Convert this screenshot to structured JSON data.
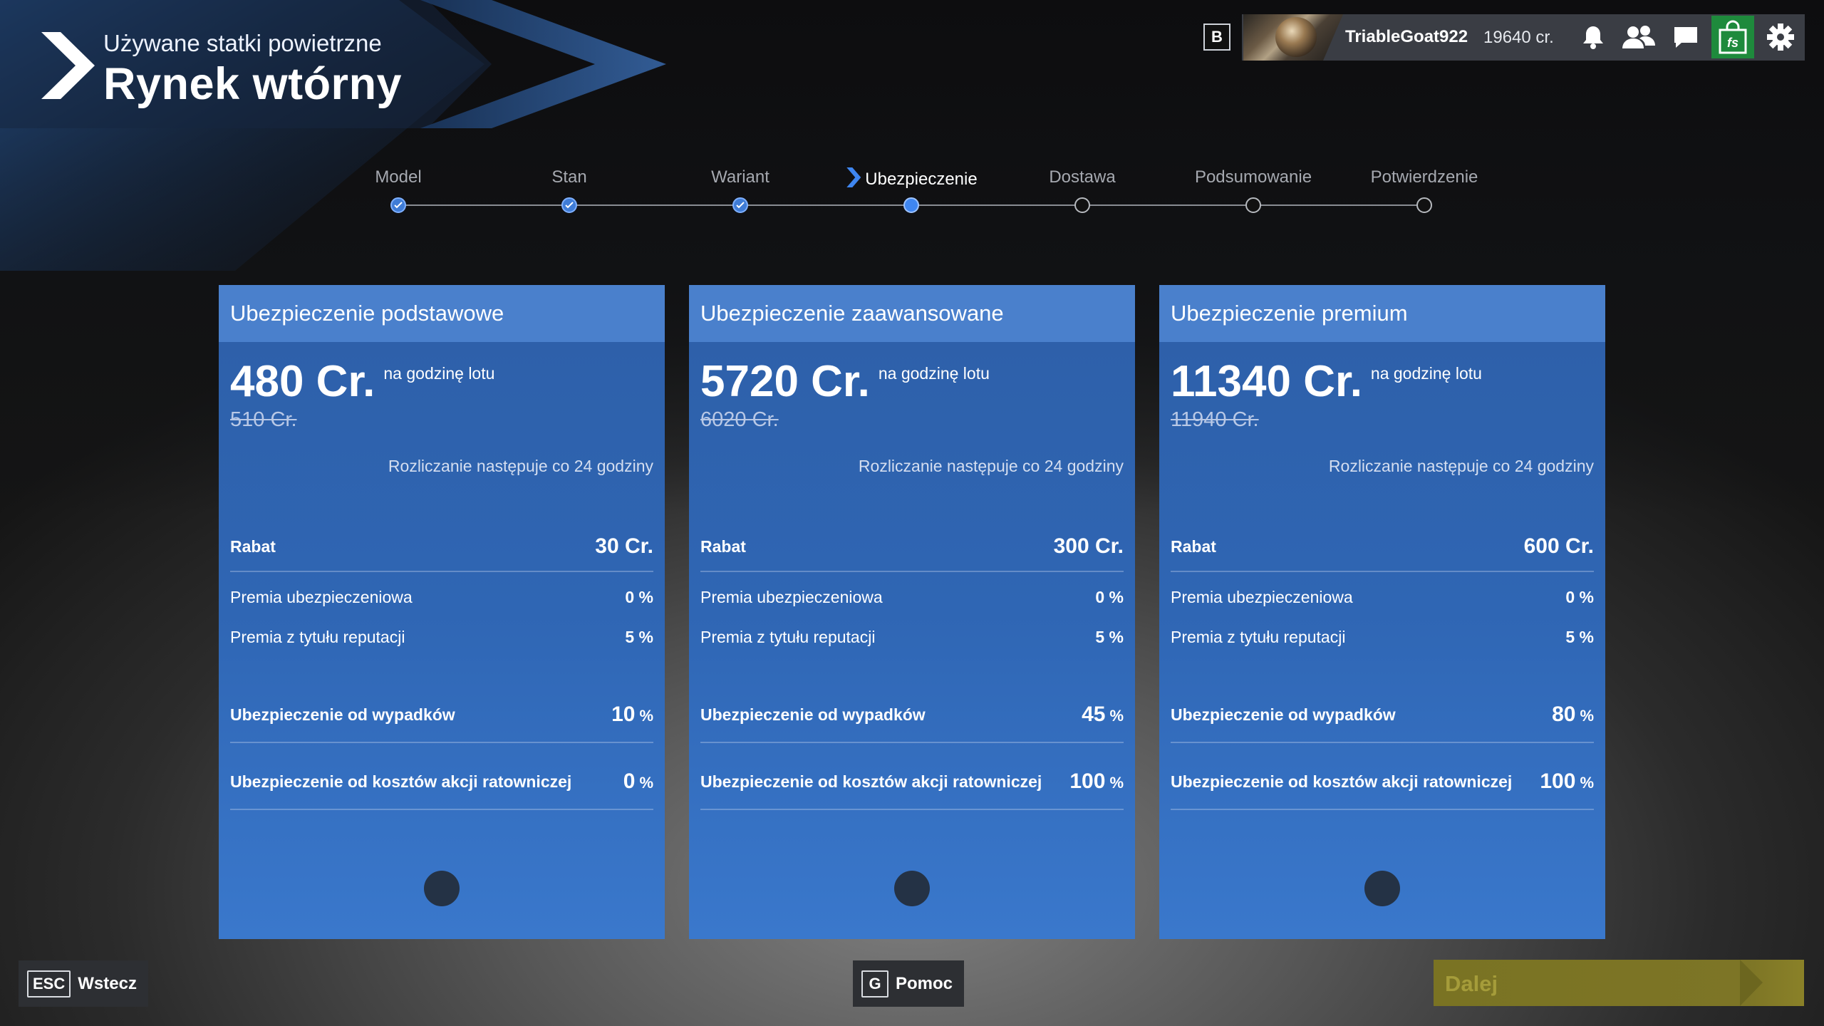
{
  "header": {
    "subtitle": "Używane statki powietrzne",
    "title": "Rynek wtórny"
  },
  "topbar": {
    "badge": "B",
    "username": "TriableGoat922",
    "credits": "19640 cr.",
    "icons": [
      "bell-icon",
      "friends-icon",
      "chat-icon",
      "shop-icon",
      "gear-icon"
    ]
  },
  "steps": [
    {
      "label": "Model",
      "state": "done"
    },
    {
      "label": "Stan",
      "state": "done"
    },
    {
      "label": "Wariant",
      "state": "done"
    },
    {
      "label": "Ubezpieczenie",
      "state": "current"
    },
    {
      "label": "Dostawa",
      "state": "todo"
    },
    {
      "label": "Podsumowanie",
      "state": "todo"
    },
    {
      "label": "Potwierdzenie",
      "state": "todo"
    }
  ],
  "cards": [
    {
      "title": "Ubezpieczenie podstawowe",
      "price": "480 Cr.",
      "per": "na godzinę lotu",
      "old_price": "510 Cr.",
      "billing": "Rozliczanie następuje co 24 godziny",
      "rabat_label": "Rabat",
      "rabat_value": "30 Cr.",
      "premia_ub_label": "Premia ubezpieczeniowa",
      "premia_ub_value": "0 %",
      "premia_rep_label": "Premia z tytułu reputacji",
      "premia_rep_value": "5 %",
      "wypadki_label": "Ubezpieczenie od wypadków",
      "wypadki_value": "10",
      "wypadki_pct": "%",
      "ratunek_label": "Ubezpieczenie od kosztów akcji ratowniczej",
      "ratunek_value": "0",
      "ratunek_pct": "%"
    },
    {
      "title": "Ubezpieczenie zaawansowane",
      "price": "5720 Cr.",
      "per": "na godzinę lotu",
      "old_price": "6020 Cr.",
      "billing": "Rozliczanie następuje co 24 godziny",
      "rabat_label": "Rabat",
      "rabat_value": "300 Cr.",
      "premia_ub_label": "Premia ubezpieczeniowa",
      "premia_ub_value": "0 %",
      "premia_rep_label": "Premia z tytułu reputacji",
      "premia_rep_value": "5 %",
      "wypadki_label": "Ubezpieczenie od wypadków",
      "wypadki_value": "45",
      "wypadki_pct": "%",
      "ratunek_label": "Ubezpieczenie od kosztów akcji ratowniczej",
      "ratunek_value": "100",
      "ratunek_pct": "%"
    },
    {
      "title": "Ubezpieczenie premium",
      "price": "11340 Cr.",
      "per": "na godzinę lotu",
      "old_price": "11940 Cr.",
      "billing": "Rozliczanie następuje co 24 godziny",
      "rabat_label": "Rabat",
      "rabat_value": "600 Cr.",
      "premia_ub_label": "Premia ubezpieczeniowa",
      "premia_ub_value": "0 %",
      "premia_rep_label": "Premia z tytułu reputacji",
      "premia_rep_value": "5 %",
      "wypadki_label": "Ubezpieczenie od wypadków",
      "wypadki_value": "80",
      "wypadki_pct": "%",
      "ratunek_label": "Ubezpieczenie od kosztów akcji ratowniczej",
      "ratunek_value": "100",
      "ratunek_pct": "%"
    }
  ],
  "bottom": {
    "back_key": "ESC",
    "back_label": "Wstecz",
    "help_key": "G",
    "help_label": "Pomoc",
    "next_label": "Dalej"
  },
  "colors": {
    "accent": "#3f86f0",
    "card": "#2f66b4",
    "card_header": "#4a80cc",
    "shop_green": "#1e8a3c",
    "next_disabled": "#7a7323"
  }
}
